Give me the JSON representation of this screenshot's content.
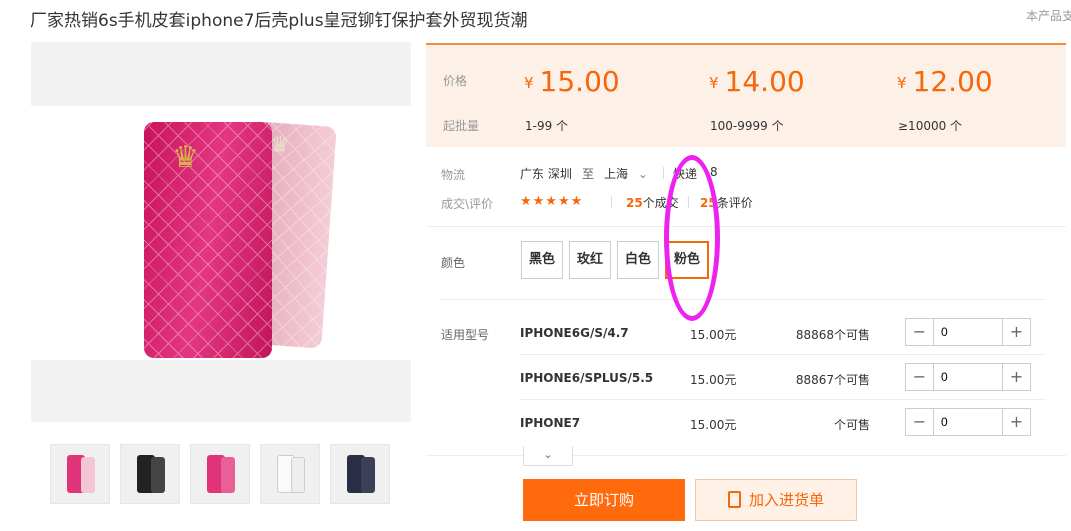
{
  "product": {
    "title": "厂家热销6s手机皮套iphone7后壳plus皇冠铆钉保护套外贸现货潮",
    "top_right_text": "本产品支"
  },
  "pricing": {
    "price_label": "价格",
    "moq_label": "起批量",
    "currency": "¥",
    "tiers": [
      {
        "price": "15.00",
        "qty": "1-99 个"
      },
      {
        "price": "14.00",
        "qty": "100-9999 个"
      },
      {
        "price": "12.00",
        "qty": "≥10000 个"
      }
    ]
  },
  "logistics": {
    "label": "物流",
    "origin": "广东 深圳",
    "to": "至",
    "destination": "上海",
    "method": "快递",
    "fee": "8"
  },
  "deals": {
    "label": "成交\\评价",
    "rating_stars": 5,
    "stars": "★★★★★",
    "deals_count": "25",
    "deals_suffix": "个成交",
    "reviews_count": "25",
    "reviews_suffix": "条评价"
  },
  "colors": {
    "label": "颜色",
    "options": [
      "黑色",
      "玫红",
      "白色",
      "粉色"
    ],
    "selected": "粉色"
  },
  "models": {
    "label": "适用型号",
    "rows": [
      {
        "name": "IPHONE6G/S/4.7",
        "price": "15.00元",
        "available": "88868个可售",
        "qty": "0"
      },
      {
        "name": "IPHONE6/SPLUS/5.5",
        "price": "15.00元",
        "available": "88867个可售",
        "qty": "0"
      },
      {
        "name": "IPHONE7",
        "price": "15.00元",
        "available": "个可售",
        "qty": "0"
      }
    ]
  },
  "actions": {
    "buy_now": "立即订购",
    "add_to_cart": "加入进货单"
  },
  "icons": {
    "minus": "−",
    "plus": "+",
    "chevron": "⌄",
    "crown": "♛"
  },
  "colors_theme": {
    "accent": "#f5670a",
    "price_bg": "#fdf0e7",
    "annotation": "#ee22ee"
  }
}
